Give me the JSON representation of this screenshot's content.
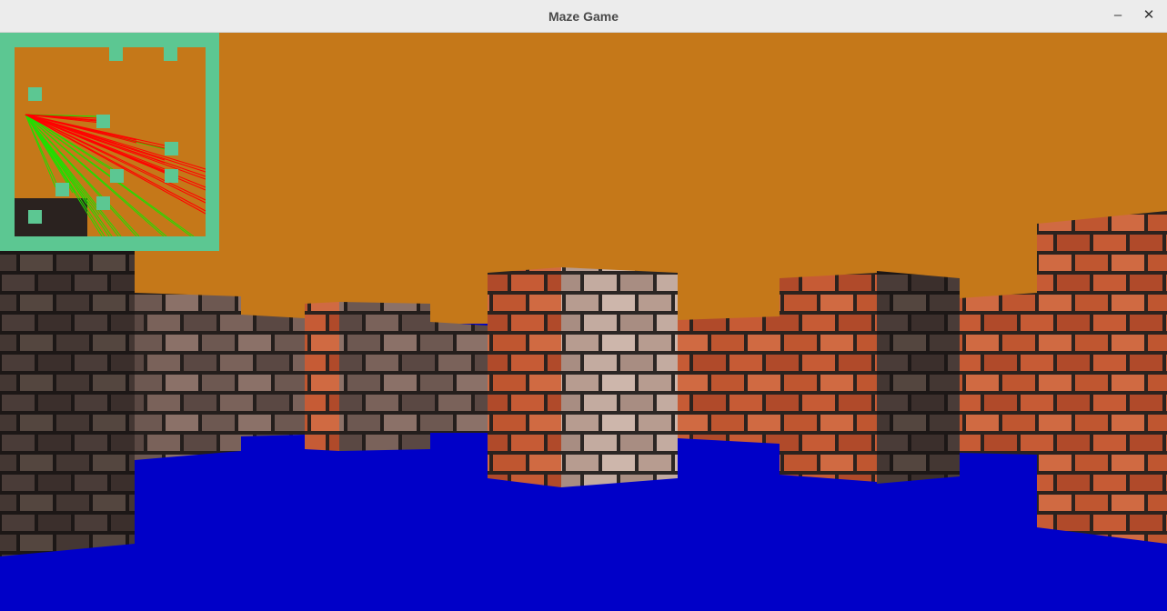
{
  "window": {
    "title": "Maze Game",
    "minimize_glyph": "–",
    "close_glyph": "✕"
  },
  "scene": {
    "ceiling_color": "#c57819",
    "floor_color": "#0000c8",
    "brick_red": "#b8532f",
    "brick_dark": "#3d3230",
    "brick_light": "#b89e92",
    "mortar_color": "#2a2522"
  },
  "minimap": {
    "wall_color": "#5cc792",
    "background_color": "#c57819",
    "ray_hit_color": "#ff0000",
    "ray_miss_color": "#22dd00"
  }
}
